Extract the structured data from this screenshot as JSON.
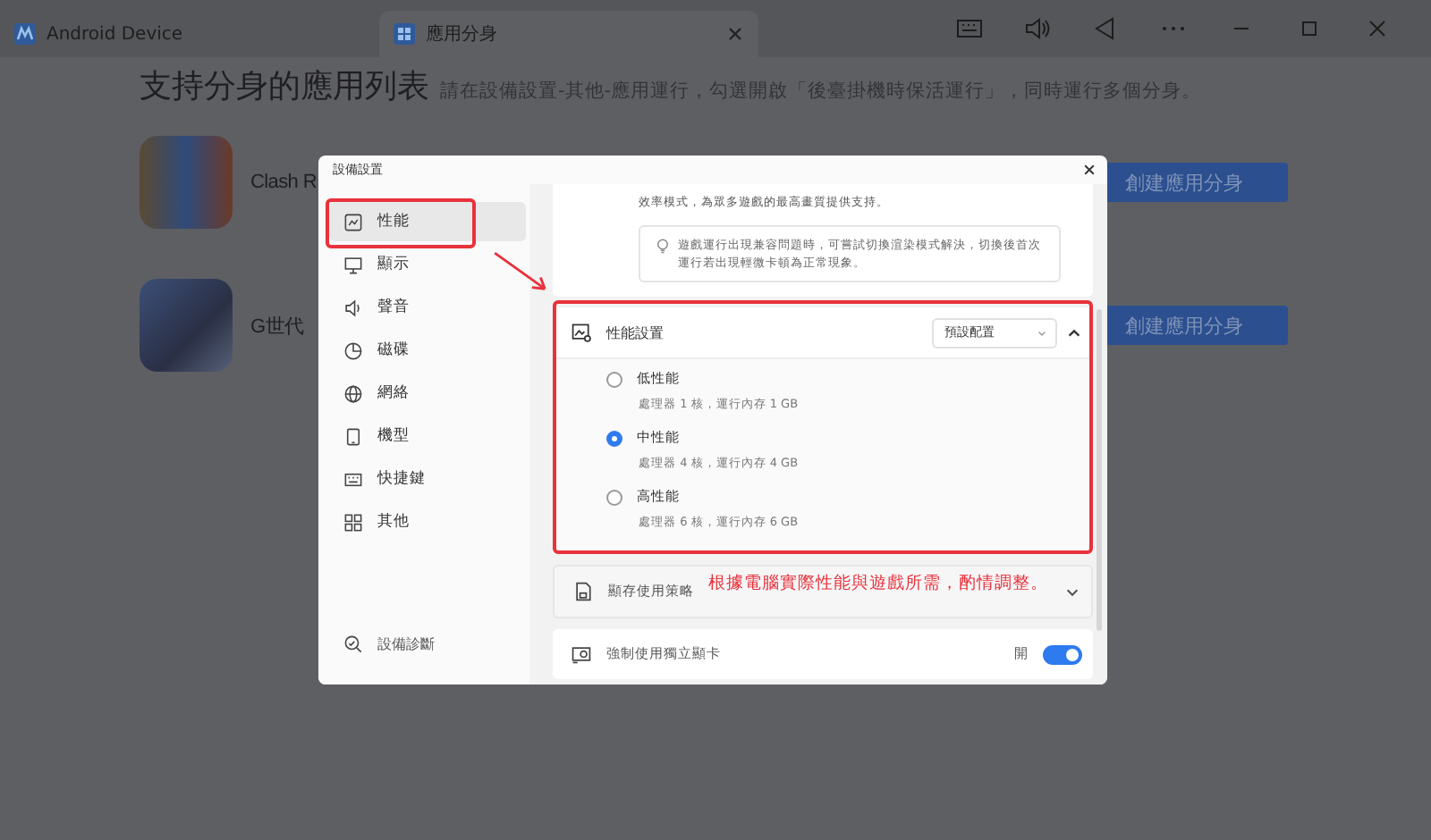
{
  "tabs": [
    {
      "label": "Android Device",
      "selected": false
    },
    {
      "label": "應用分身",
      "selected": true
    }
  ],
  "page": {
    "title": "支持分身的應用列表",
    "hint": "請在設備設置-其他-應用運行，勾選開啟「後臺掛機時保活運行」，同時運行多個分身。",
    "apps": [
      {
        "name": "Clash R",
        "button": "創建應用分身"
      },
      {
        "name": "G世代",
        "button": "創建應用分身"
      }
    ]
  },
  "dialog": {
    "title": "設備設置",
    "nav": [
      {
        "label": "性能",
        "selected": true
      },
      {
        "label": "顯示",
        "selected": false
      },
      {
        "label": "聲音",
        "selected": false
      },
      {
        "label": "磁碟",
        "selected": false
      },
      {
        "label": "網絡",
        "selected": false
      },
      {
        "label": "機型",
        "selected": false
      },
      {
        "label": "快捷鍵",
        "selected": false
      },
      {
        "label": "其他",
        "selected": false
      }
    ],
    "diagnostics": "設備診斷",
    "render_note": "效率模式，為眾多遊戲的最高畫質提供支持。",
    "tip": "遊戲運行出現兼容問題時，可嘗試切換渲染模式解決，切換後首次運行若出現輕微卡頓為正常現象。",
    "performance": {
      "title": "性能設置",
      "preset": "預設配置",
      "expanded": true,
      "options": [
        {
          "label": "低性能",
          "detail": "處理器 1 核，運行內存 1 GB",
          "selected": false
        },
        {
          "label": "中性能",
          "detail": "處理器 4 核，運行內存 4 GB",
          "selected": true
        },
        {
          "label": "高性能",
          "detail": "處理器 6 核，運行內存 6 GB",
          "selected": false
        }
      ]
    },
    "memory": {
      "title": "顯存使用策略",
      "expanded": false
    },
    "gpu": {
      "title": "強制使用獨立顯卡",
      "state_label": "開",
      "on": true
    }
  },
  "annotation": {
    "caption": "根據電腦實際性能與遊戲所需，酌情調整。"
  }
}
